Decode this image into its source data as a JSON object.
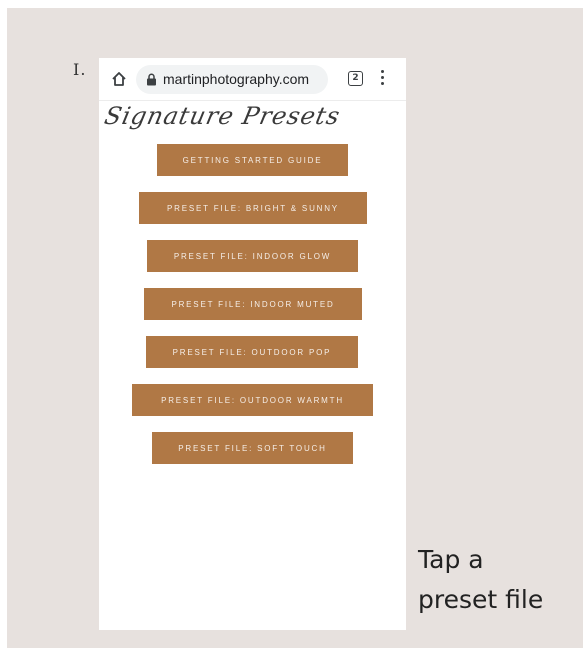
{
  "step": {
    "number": "I."
  },
  "browser": {
    "url": "martinphotography.com",
    "tab_count": "2"
  },
  "page": {
    "title": "Signature Presets",
    "buttons": [
      "GETTING STARTED GUIDE",
      "PRESET FILE: BRIGHT & SUNNY",
      "PRESET FILE: INDOOR GLOW",
      "PRESET FILE: INDOOR MUTED",
      "PRESET FILE: OUTDOOR POP",
      "PRESET FILE: OUTDOOR WARMTH",
      "PRESET FILE: SOFT TOUCH"
    ]
  },
  "instruction": {
    "line1": "Tap a",
    "line2": "preset file"
  },
  "colors": {
    "background": "#e7e1de",
    "button": "#b07845",
    "button_text": "#f5eee8"
  }
}
